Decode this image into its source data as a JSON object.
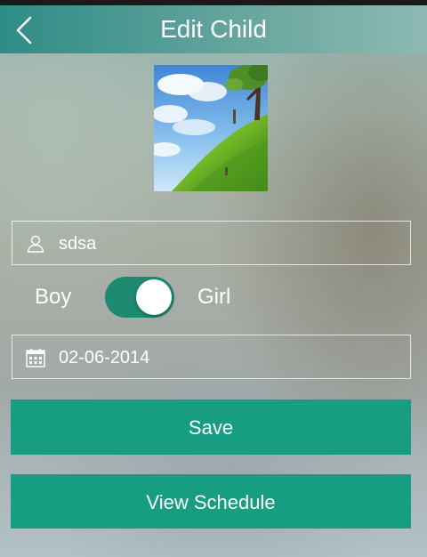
{
  "header": {
    "title": "Edit Child",
    "back_icon": "chevron-left-icon"
  },
  "photo": {
    "description_icon": "child-photo"
  },
  "form": {
    "name": {
      "icon": "user-icon",
      "value": "sdsa"
    },
    "gender": {
      "left_label": "Boy",
      "right_label": "Girl",
      "selected": "Girl"
    },
    "dob": {
      "icon": "calendar-icon",
      "value": "02-06-2014"
    }
  },
  "actions": {
    "save_label": "Save",
    "schedule_label": "View Schedule"
  },
  "colors": {
    "accent": "#179d82",
    "toggle_on": "#1e8a72",
    "navbar": "#2e8c86"
  }
}
